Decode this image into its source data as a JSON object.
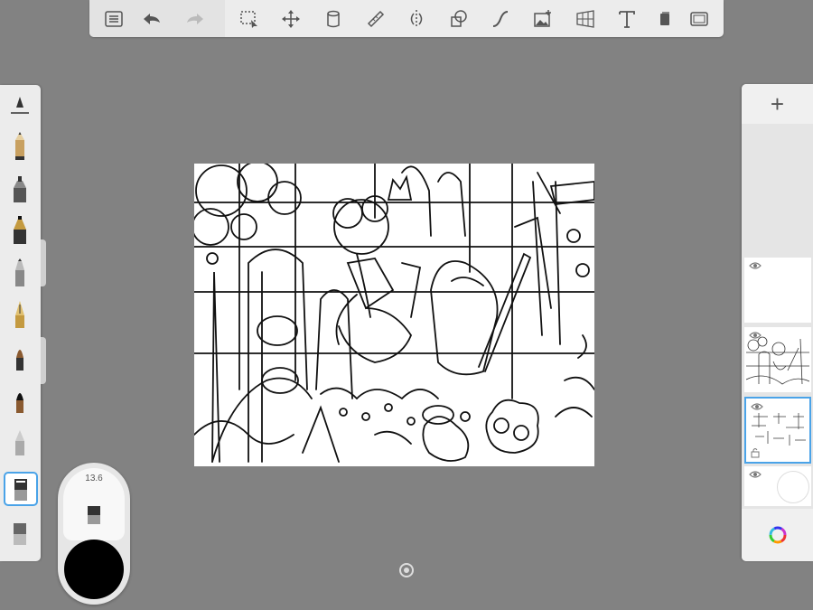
{
  "toolbar": {
    "tools": [
      "list-icon",
      "undo-icon",
      "redo-icon",
      "selection-icon",
      "transform-icon",
      "fill-icon",
      "ruler-icon",
      "symmetry-icon",
      "shapes-icon",
      "curve-icon",
      "image-import-icon",
      "perspective-icon",
      "text-icon",
      "flipbook-icon",
      "fullscreen-icon"
    ]
  },
  "brushes": [
    "brush-size-slider-icon",
    "pencil-icon",
    "airbrush-icon",
    "ballpoint-icon",
    "marker-icon",
    "fountain-pen-icon",
    "paintbrush-icon",
    "fine-brush-icon",
    "smudge-icon",
    "eraser-icon",
    "soft-eraser-icon"
  ],
  "puck": {
    "brush_size": "13.6",
    "current_color": "#000000"
  },
  "layers": {
    "add_label": "+",
    "items": [
      "empty-layer",
      "sketch-layer",
      "grid-lines-layer",
      "background-layer"
    ]
  },
  "colors": {
    "accent": "#4aa3e8",
    "background": "#828282"
  }
}
